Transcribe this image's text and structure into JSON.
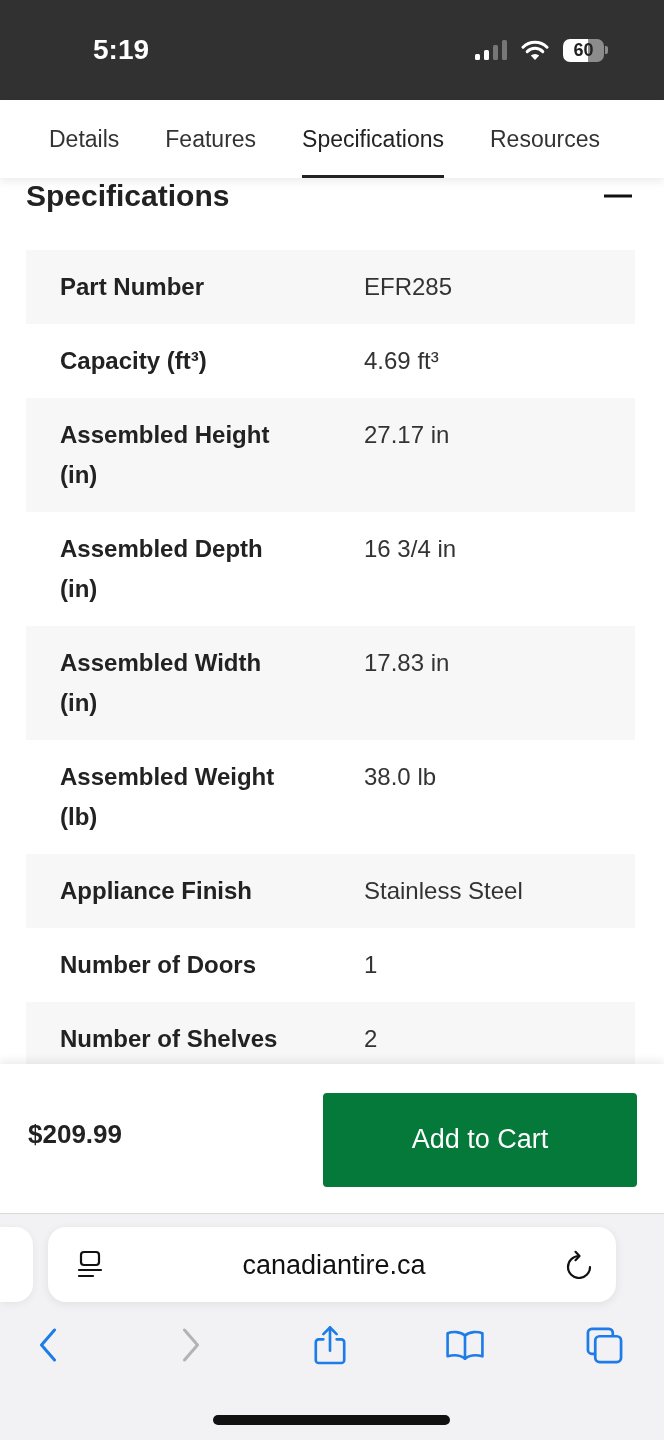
{
  "status_bar": {
    "time": "5:19",
    "battery": "60"
  },
  "tabs": [
    {
      "label": "Details",
      "selected": false
    },
    {
      "label": "Features",
      "selected": false
    },
    {
      "label": "Specifications",
      "selected": true
    },
    {
      "label": "Resources",
      "selected": false
    }
  ],
  "section": {
    "title": "Specifications",
    "expanded": true
  },
  "specs": [
    {
      "label": "Part Number",
      "value": "EFR285"
    },
    {
      "label": "Capacity (ft³)",
      "value": "4.69 ft³"
    },
    {
      "label": "Assembled Height (in)",
      "value": "27.17 in"
    },
    {
      "label": "Assembled Depth (in)",
      "value": "16 3/4 in"
    },
    {
      "label": "Assembled Width (in)",
      "value": "17.83 in"
    },
    {
      "label": "Assembled Weight (lb)",
      "value": "38.0 lb"
    },
    {
      "label": "Appliance Finish",
      "value": "Stainless Steel"
    },
    {
      "label": "Number of Doors",
      "value": "1"
    },
    {
      "label": "Number of Shelves",
      "value": "2"
    }
  ],
  "purchase_bar": {
    "price": "$209.99",
    "button": "Add to Cart"
  },
  "browser": {
    "url": "canadiantire.ca",
    "toolbar": [
      {
        "kind": "back",
        "disabled": false
      },
      {
        "kind": "forward",
        "disabled": true
      },
      {
        "kind": "share",
        "disabled": false
      },
      {
        "kind": "bookmarks",
        "disabled": false
      },
      {
        "kind": "tabs",
        "disabled": false
      }
    ]
  }
}
